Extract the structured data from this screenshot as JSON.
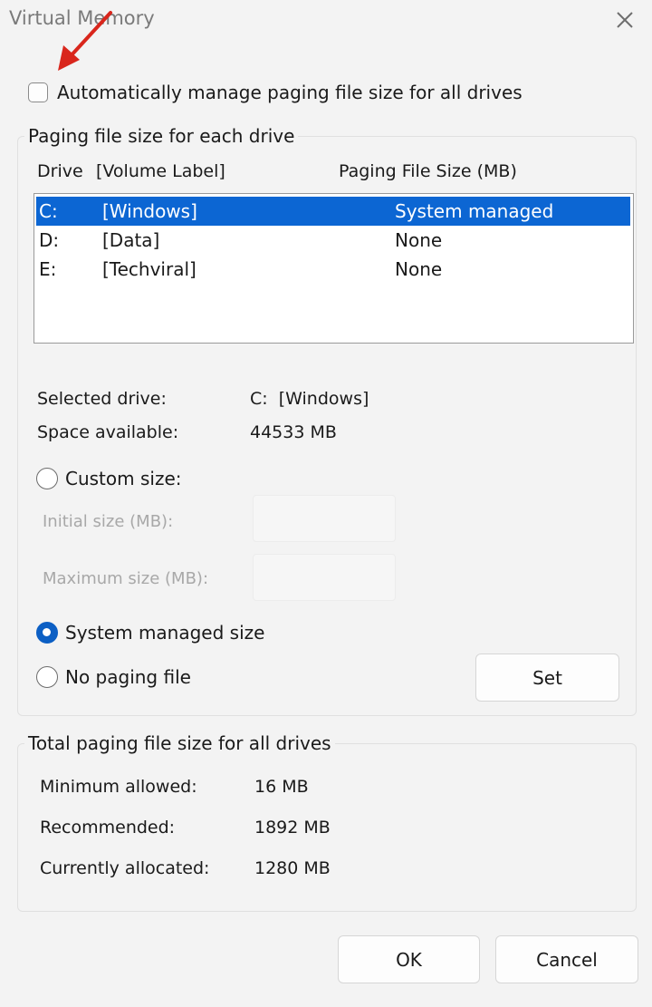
{
  "window": {
    "title": "Virtual Memory"
  },
  "auto_manage": {
    "label": "Automatically manage paging file size for all drives",
    "checked": false
  },
  "drives_group": {
    "title": "Paging file size for each drive",
    "headers": {
      "drive": "Drive",
      "volume": "[Volume Label]",
      "size": "Paging File Size (MB)"
    },
    "rows": [
      {
        "drive": "C:",
        "label": "[Windows]",
        "size": "System managed",
        "selected": true
      },
      {
        "drive": "D:",
        "label": "[Data]",
        "size": "None",
        "selected": false
      },
      {
        "drive": "E:",
        "label": "[Techviral]",
        "size": "None",
        "selected": false
      }
    ],
    "selected_drive_label": "Selected drive:",
    "selected_drive_value": "C:  [Windows]",
    "space_label": "Space available:",
    "space_value": "44533 MB",
    "custom_size": {
      "label": "Custom size:",
      "selected": false
    },
    "initial_size_label": "Initial size (MB):",
    "maximum_size_label": "Maximum size (MB):",
    "system_managed": {
      "label": "System managed size",
      "selected": true
    },
    "no_paging": {
      "label": "No paging file",
      "selected": false
    },
    "set_button": "Set"
  },
  "totals_group": {
    "title": "Total paging file size for all drives",
    "minimum_label": "Minimum allowed:",
    "minimum_value": "16 MB",
    "recommended_label": "Recommended:",
    "recommended_value": "1892 MB",
    "allocated_label": "Currently allocated:",
    "allocated_value": "1280 MB"
  },
  "buttons": {
    "ok": "OK",
    "cancel": "Cancel"
  },
  "colors": {
    "selection": "#0c66d3",
    "radio_selected": "#0c5fc4",
    "annotation_arrow": "#d9261c"
  }
}
